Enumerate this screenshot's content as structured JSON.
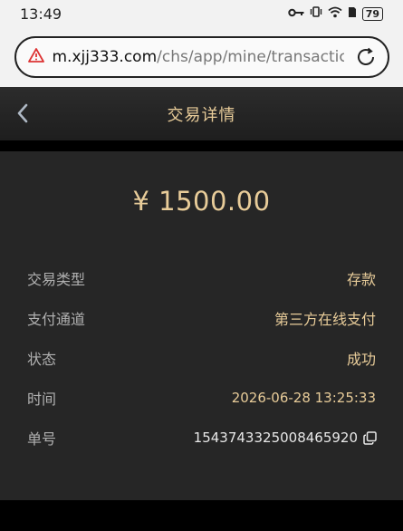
{
  "status_bar": {
    "time": "13:49",
    "battery": "79"
  },
  "browser": {
    "url_host": "m.xjj333.com",
    "url_path": "/chs/app/mine/transactic"
  },
  "header": {
    "title": "交易详情"
  },
  "transaction": {
    "amount": "¥ 1500.00",
    "rows": [
      {
        "label": "交易类型",
        "value": "存款"
      },
      {
        "label": "支付通道",
        "value": "第三方在线支付"
      },
      {
        "label": "状态",
        "value": "成功"
      },
      {
        "label": "时间",
        "value": "2026-06-28 13:25:33"
      },
      {
        "label": "单号",
        "value": "1543743325008465920"
      }
    ]
  },
  "colors": {
    "accent": "#e8cc99",
    "card": "#262626",
    "background": "#000000"
  }
}
